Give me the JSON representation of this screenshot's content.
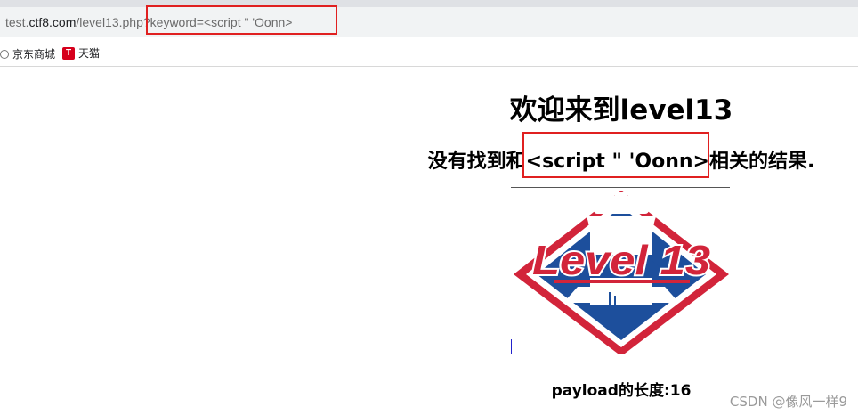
{
  "browser": {
    "url_prefix": "test.",
    "url_host": "ctf8.com",
    "url_rest": "/level13.php?keyword=<script \" 'Oonn>",
    "bookmarks": [
      {
        "label": "京东商城",
        "icon": "globe-icon"
      },
      {
        "label": "天猫",
        "icon": "tmall-icon",
        "icon_text": "T"
      }
    ]
  },
  "page": {
    "title": "欢迎来到level13",
    "subtitle": "没有找到和<script \" 'Oonn>相关的结果.",
    "logo_text": "Level 13",
    "payload_text": "payload的长度:16"
  },
  "watermark": "CSDN @像风一样9",
  "colors": {
    "highlight_box": "#e02020",
    "logo_blue": "#1d4f9c",
    "logo_red": "#d2243a",
    "logo_white": "#ffffff"
  }
}
